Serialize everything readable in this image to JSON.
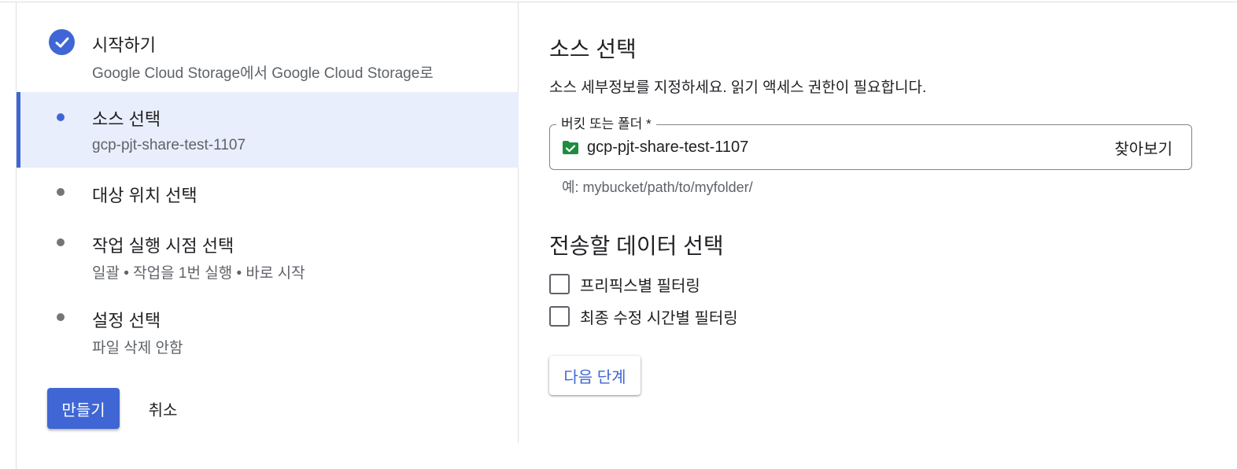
{
  "colors": {
    "accent": "#3f66d4",
    "selected_bg": "#e8eefb",
    "text": "#202124",
    "secondary_text": "#5f6368",
    "bucket_icon": "#1e8e3e"
  },
  "stepper": {
    "steps": [
      {
        "title": "시작하기",
        "subtitle": "Google Cloud Storage에서 Google Cloud Storage로",
        "state": "completed",
        "icon": "check-circle-icon"
      },
      {
        "title": "소스 선택",
        "subtitle": "gcp-pjt-share-test-1107",
        "state": "active"
      },
      {
        "title": "대상 위치 선택",
        "subtitle": "",
        "state": "pending"
      },
      {
        "title": "작업 실행 시점 선택",
        "subtitle": "일괄 • 작업을 1번 실행 • 바로 시작",
        "state": "pending"
      },
      {
        "title": "설정 선택",
        "subtitle": "파일 삭제 안함",
        "state": "pending"
      }
    ],
    "create_label": "만들기",
    "cancel_label": "취소"
  },
  "form": {
    "section_title": "소스 선택",
    "description": "소스 세부정보를 지정하세요. 읽기 액세스 권한이 필요합니다.",
    "bucket_field": {
      "label": "버킷 또는 폴더 *",
      "value": "gcp-pjt-share-test-1107",
      "icon": "bucket-check-icon",
      "browse_label": "찾아보기",
      "hint": "예: mybucket/path/to/myfolder/"
    },
    "data_section_title": "전송할 데이터 선택",
    "filters": [
      {
        "label": "프리픽스별 필터링",
        "checked": false
      },
      {
        "label": "최종 수정 시간별 필터링",
        "checked": false
      }
    ],
    "next_label": "다음 단계"
  }
}
